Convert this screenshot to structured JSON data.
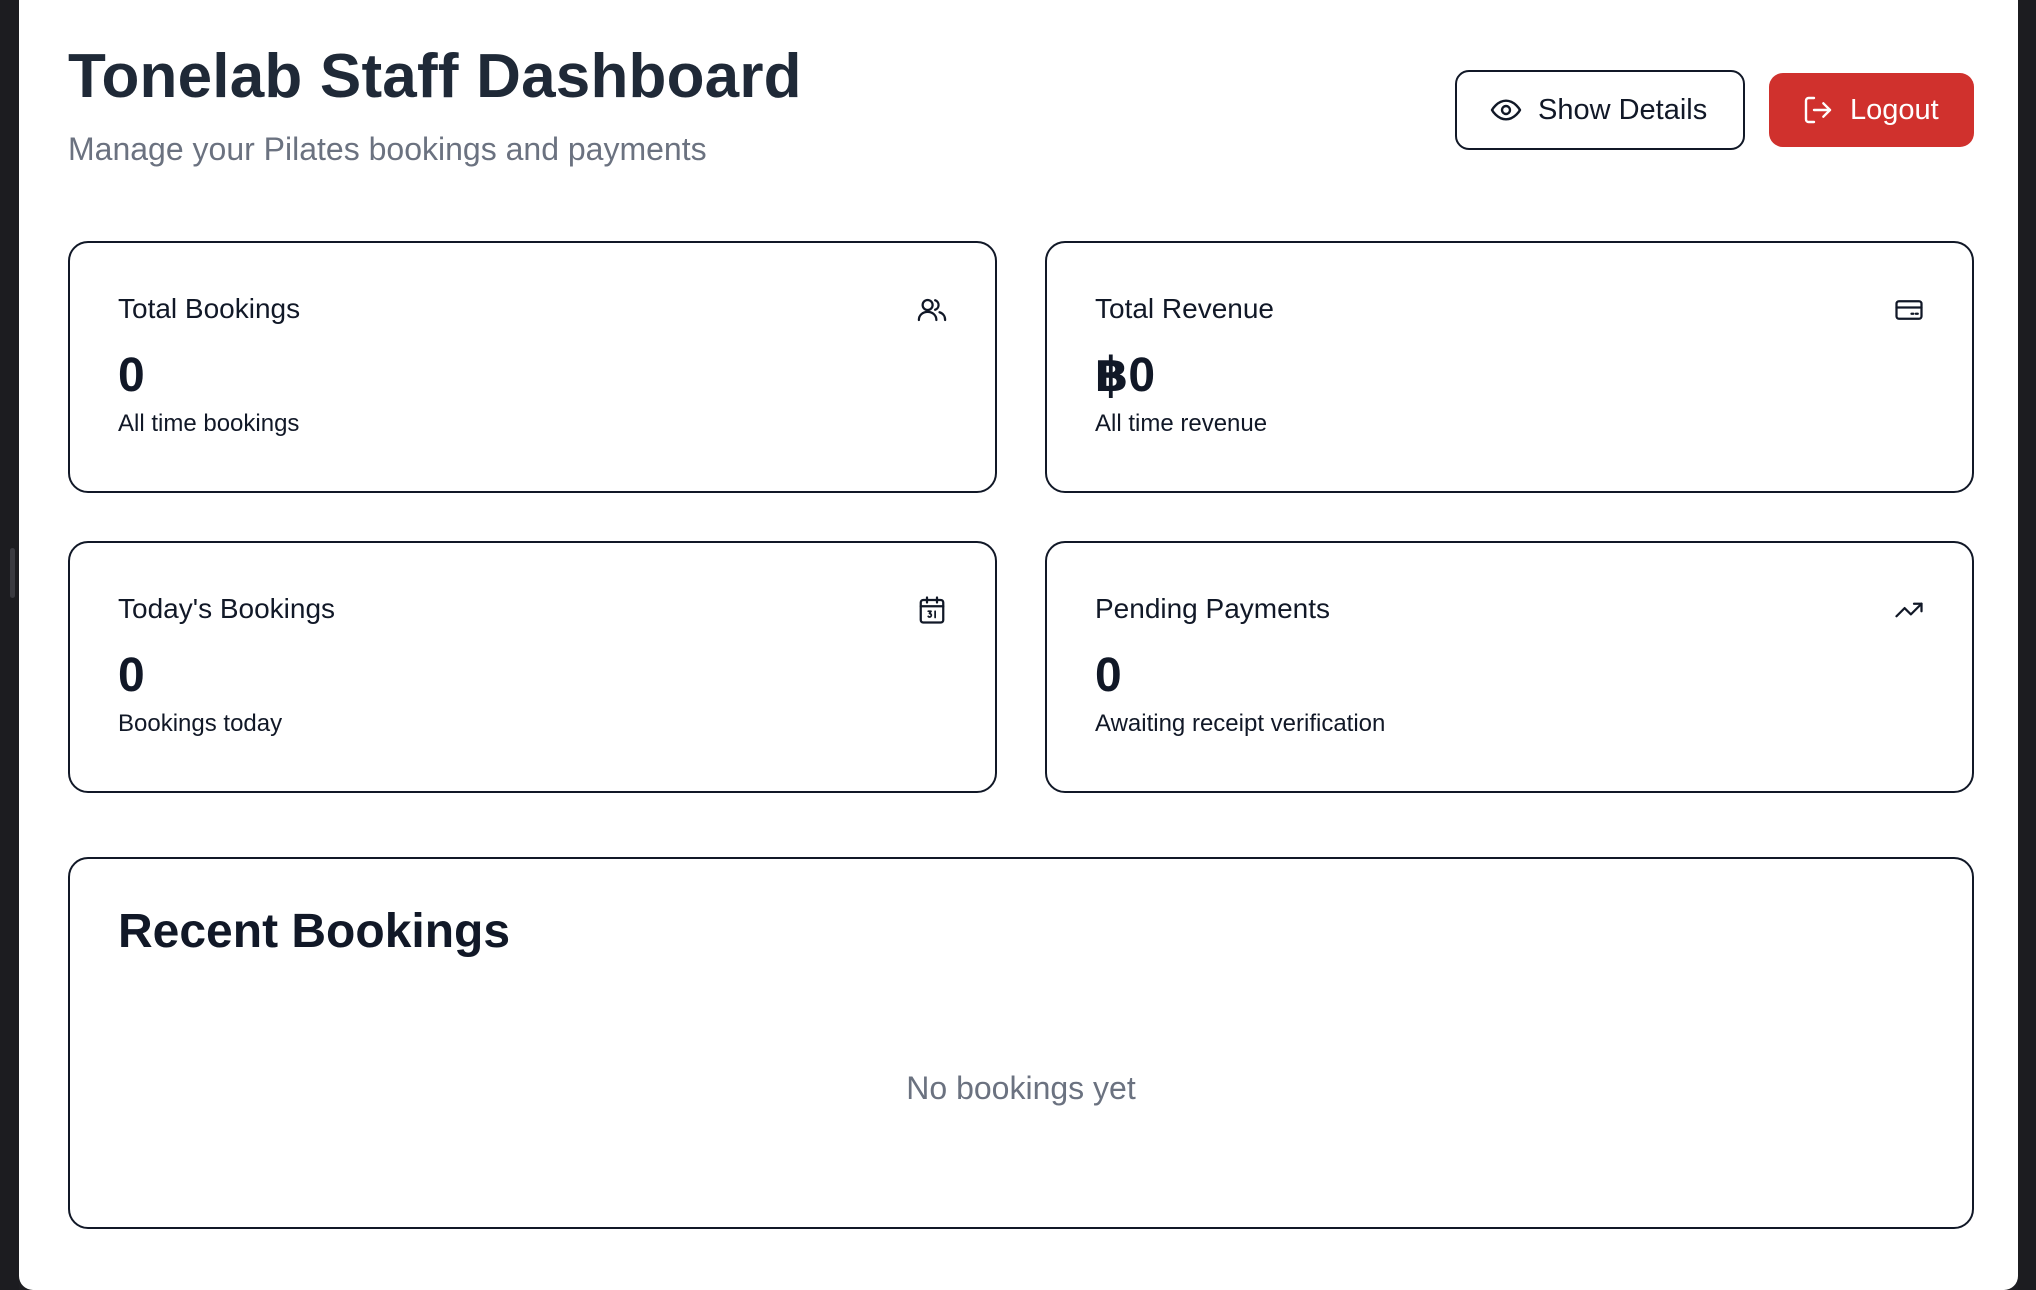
{
  "header": {
    "title": "Tonelab Staff Dashboard",
    "subtitle": "Manage your Pilates bookings and payments",
    "show_details_label": "Show Details",
    "logout_label": "Logout"
  },
  "stats": [
    {
      "label": "Total Bookings",
      "value": "0",
      "description": "All time bookings",
      "icon": "users-icon"
    },
    {
      "label": "Total Revenue",
      "value": "฿0",
      "description": "All time revenue",
      "icon": "credit-card-icon"
    },
    {
      "label": "Today's Bookings",
      "value": "0",
      "description": "Bookings today",
      "icon": "calendar-icon"
    },
    {
      "label": "Pending Payments",
      "value": "0",
      "description": "Awaiting receipt verification",
      "icon": "trending-up-icon"
    }
  ],
  "recent_bookings": {
    "title": "Recent Bookings",
    "empty_message": "No bookings yet"
  },
  "colors": {
    "logout_bg": "#d0312d",
    "title_text": "#1f2937",
    "muted_text": "#6b7280"
  }
}
